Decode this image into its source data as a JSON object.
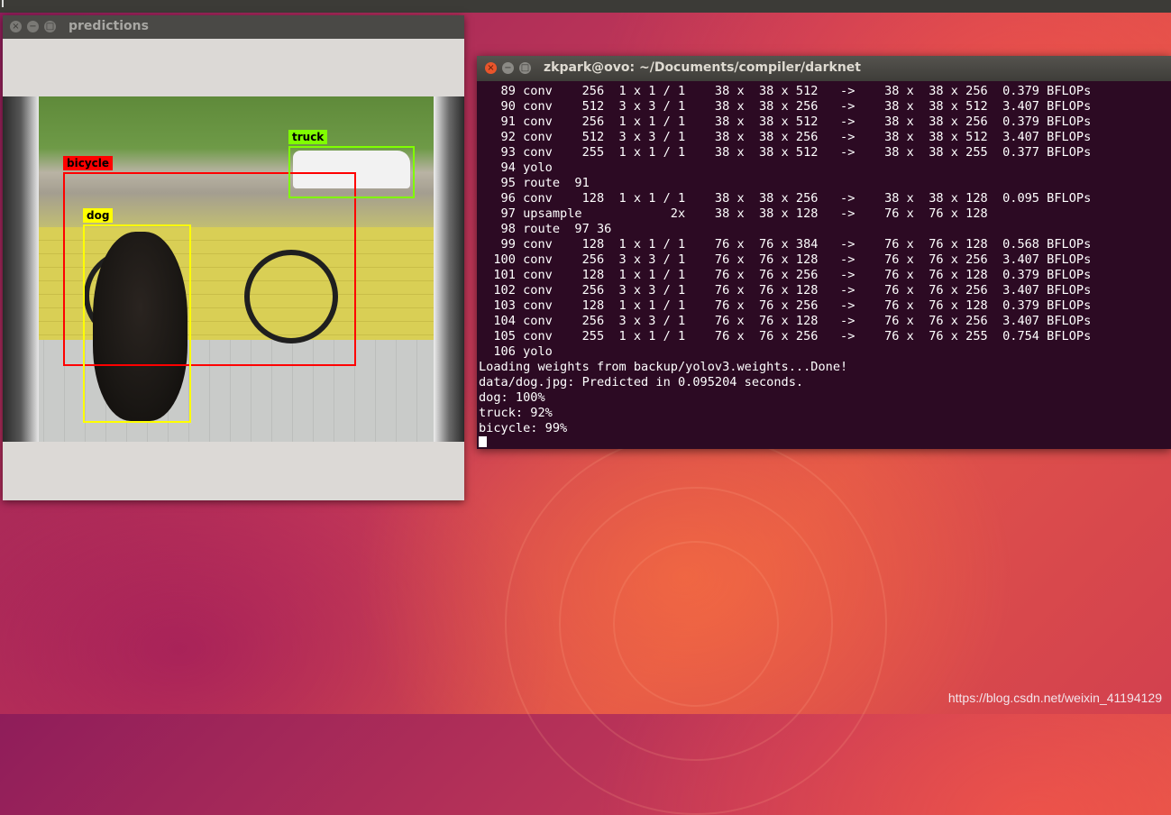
{
  "predictions_window": {
    "title": "predictions",
    "detections": [
      {
        "label": "bicycle",
        "color": "#ff0000"
      },
      {
        "label": "truck",
        "color": "#80ff00"
      },
      {
        "label": "dog",
        "color": "#ffff00"
      }
    ]
  },
  "terminal_window": {
    "title": "zkpark@ovo: ~/Documents/compiler/darknet",
    "lines": [
      "   89 conv    256  1 x 1 / 1    38 x  38 x 512   ->    38 x  38 x 256  0.379 BFLOPs",
      "   90 conv    512  3 x 3 / 1    38 x  38 x 256   ->    38 x  38 x 512  3.407 BFLOPs",
      "   91 conv    256  1 x 1 / 1    38 x  38 x 512   ->    38 x  38 x 256  0.379 BFLOPs",
      "   92 conv    512  3 x 3 / 1    38 x  38 x 256   ->    38 x  38 x 512  3.407 BFLOPs",
      "   93 conv    255  1 x 1 / 1    38 x  38 x 512   ->    38 x  38 x 255  0.377 BFLOPs",
      "   94 yolo",
      "   95 route  91",
      "   96 conv    128  1 x 1 / 1    38 x  38 x 256   ->    38 x  38 x 128  0.095 BFLOPs",
      "   97 upsample            2x    38 x  38 x 128   ->    76 x  76 x 128",
      "   98 route  97 36",
      "   99 conv    128  1 x 1 / 1    76 x  76 x 384   ->    76 x  76 x 128  0.568 BFLOPs",
      "  100 conv    256  3 x 3 / 1    76 x  76 x 128   ->    76 x  76 x 256  3.407 BFLOPs",
      "  101 conv    128  1 x 1 / 1    76 x  76 x 256   ->    76 x  76 x 128  0.379 BFLOPs",
      "  102 conv    256  3 x 3 / 1    76 x  76 x 128   ->    76 x  76 x 256  3.407 BFLOPs",
      "  103 conv    128  1 x 1 / 1    76 x  76 x 256   ->    76 x  76 x 128  0.379 BFLOPs",
      "  104 conv    256  3 x 3 / 1    76 x  76 x 128   ->    76 x  76 x 256  3.407 BFLOPs",
      "  105 conv    255  1 x 1 / 1    76 x  76 x 256   ->    76 x  76 x 255  0.754 BFLOPs",
      "  106 yolo",
      "Loading weights from backup/yolov3.weights...Done!",
      "data/dog.jpg: Predicted in 0.095204 seconds.",
      "dog: 100%",
      "truck: 92%",
      "bicycle: 99%"
    ]
  },
  "window_controls": {
    "close_glyph": "×",
    "minimize_glyph": "−",
    "maximize_glyph": "□"
  },
  "watermark": "https://blog.csdn.net/weixin_41194129",
  "colors": {
    "terminal_bg": "#2c0a23",
    "titlebar": "#4a4946",
    "close_button": "#e9552b"
  }
}
